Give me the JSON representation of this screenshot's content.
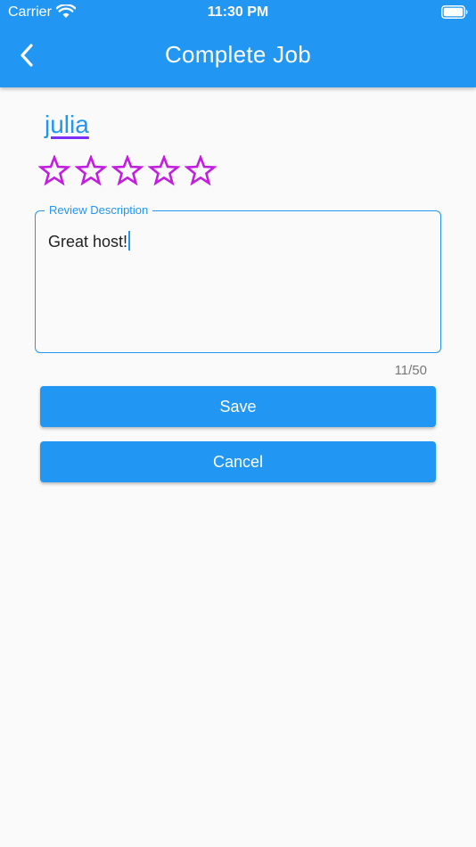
{
  "status_bar": {
    "carrier": "Carrier",
    "time": "11:30 PM"
  },
  "app_bar": {
    "title": "Complete Job",
    "back_icon": "chevron-left-icon"
  },
  "host": {
    "name": "julia"
  },
  "rating": {
    "value": 0,
    "max": 5,
    "star_color": "#c21de0"
  },
  "review": {
    "label": "Review Description",
    "value": "Great host!",
    "counter": "11/50"
  },
  "actions": {
    "save_label": "Save",
    "cancel_label": "Cancel"
  },
  "colors": {
    "primary": "#2196f3",
    "background": "#fafafa",
    "link_underline": "#7b2ff7"
  }
}
